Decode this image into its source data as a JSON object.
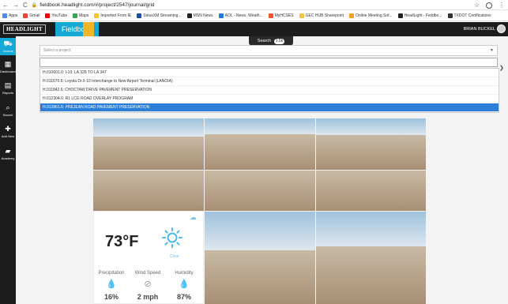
{
  "browser": {
    "url": "fieldbook.headlight.com/#/project/2547/journal/grid",
    "nav_back": "←",
    "nav_forward": "→",
    "nav_reload": "C",
    "lock": "🔒",
    "star": "☆",
    "menu": "⋮"
  },
  "bookmarks": [
    {
      "label": "Apps",
      "color": "#4c8bf5"
    },
    {
      "label": "Gmail",
      "color": "#ea4335"
    },
    {
      "label": "YouTube",
      "color": "#ff0000"
    },
    {
      "label": "Maps",
      "color": "#34a853"
    },
    {
      "label": "Imported From IE",
      "color": "#f5c342"
    },
    {
      "label": "SiriusXM Streaming...",
      "color": "#1a4fa3"
    },
    {
      "label": "MSN News",
      "color": "#222222"
    },
    {
      "label": "AOL - News, Weath...",
      "color": "#1f7ae0"
    },
    {
      "label": "MyHCSES",
      "color": "#e85a2a"
    },
    {
      "label": "GEC HUB Sharepoint",
      "color": "#f5c342"
    },
    {
      "label": "Online Meeting Sof...",
      "color": "#f0a020"
    },
    {
      "label": "HeadLight - Fieldbo...",
      "color": "#222222"
    },
    {
      "label": "TXDOT Certifications",
      "color": "#333333"
    }
  ],
  "app": {
    "logo": "HEADLIGHT",
    "product": "Fieldbook",
    "user": "BRIAN BUCKEL",
    "search_label": "Search",
    "search_count": "1.5k"
  },
  "sidebar": [
    {
      "label": "Journal",
      "icon": "⛟",
      "active": true
    },
    {
      "label": "Dashboards",
      "icon": "▦",
      "active": false
    },
    {
      "label": "Reports",
      "icon": "▤",
      "active": false
    },
    {
      "label": "Search",
      "icon": "⌕",
      "active": false
    },
    {
      "label": "Add New",
      "icon": "✚",
      "active": false
    },
    {
      "label": "Academy",
      "icon": "▰",
      "active": false
    }
  ],
  "project_select": {
    "placeholder": "Select a project",
    "options": [
      "H.010601.6: I-10: LA 328 TO LA 347",
      "H.011670.6: Loyola Dr./I-10 Interchange to New Airport Terminal (LANOIA)",
      "H.011842.6: CHOCTAW DRIVE PAVEMENT PRESERVATION",
      "H.012304.6: R1 LCG ROAD OVERLAY PROGRAM",
      "H.012861.6: PREJEAN ROAD PAVEMENT PRESERVATION"
    ],
    "selected_index": 4
  },
  "weather": {
    "temperature": "73°F",
    "condition": "Clear",
    "precip_label": "Precipitation",
    "precip_value": "16%",
    "wind_label": "Wind Speed",
    "wind_value": "2 mph",
    "humidity_label": "Humidity",
    "humidity_value": "87%",
    "sun_color": "#4cb8e8"
  },
  "photos": [
    {
      "name": "photo-1"
    },
    {
      "name": "photo-2"
    },
    {
      "name": "photo-3"
    },
    {
      "name": "photo-4"
    },
    {
      "name": "photo-5"
    },
    {
      "name": "photo-6"
    },
    {
      "name": "photo-7"
    },
    {
      "name": "photo-8"
    }
  ]
}
